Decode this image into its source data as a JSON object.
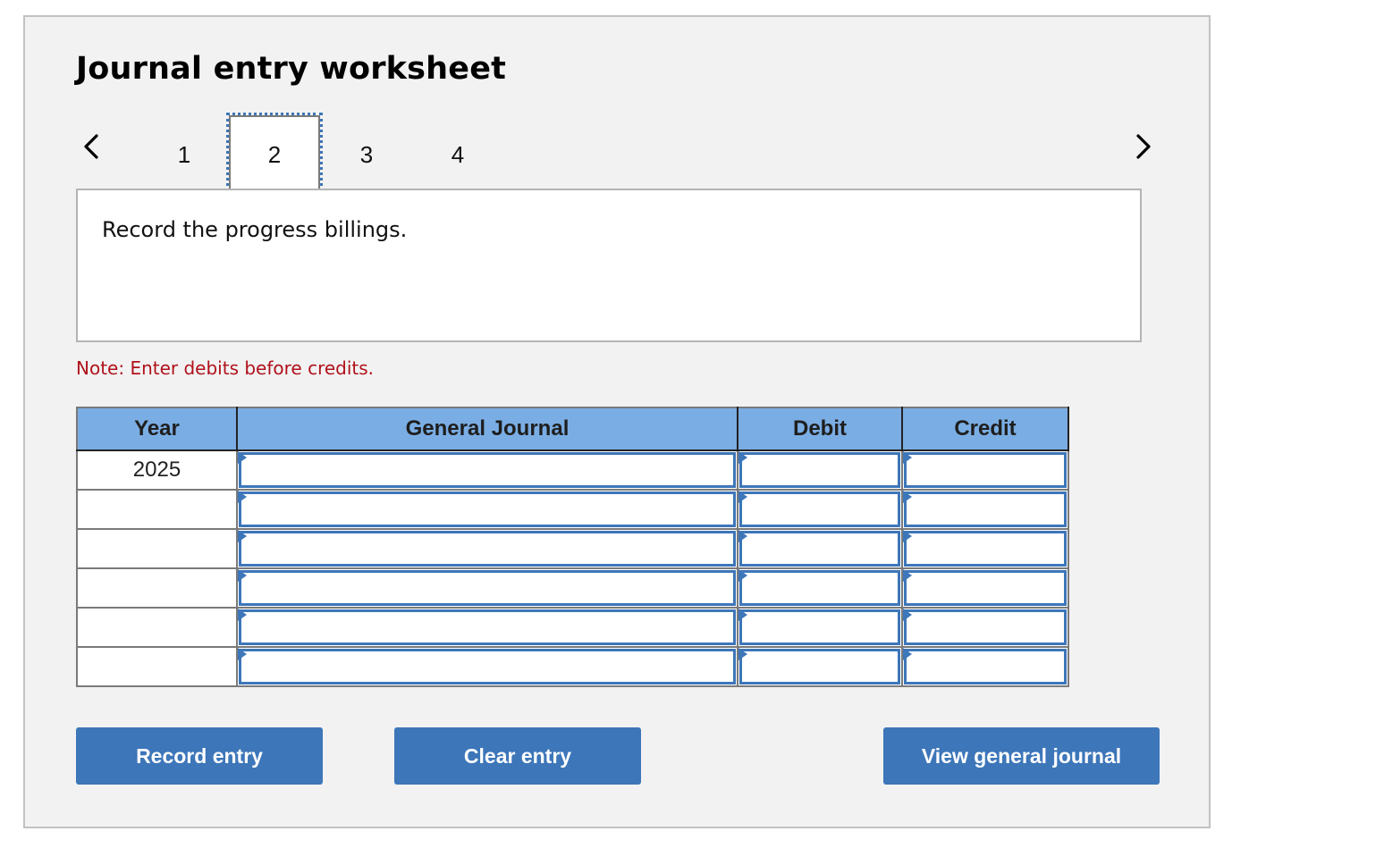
{
  "title": "Journal entry worksheet",
  "pager": {
    "prev_icon": "chevron-left-icon",
    "next_icon": "chevron-right-icon",
    "pages": [
      "1",
      "2",
      "3",
      "4"
    ],
    "selected_page": "2"
  },
  "prompt": "Record the progress billings.",
  "note": "Note: Enter debits before credits.",
  "table": {
    "headers": [
      "Year",
      "General Journal",
      "Debit",
      "Credit"
    ],
    "rows": [
      {
        "year": "2025",
        "account": "",
        "debit": "",
        "credit": ""
      },
      {
        "year": "",
        "account": "",
        "debit": "",
        "credit": ""
      },
      {
        "year": "",
        "account": "",
        "debit": "",
        "credit": ""
      },
      {
        "year": "",
        "account": "",
        "debit": "",
        "credit": ""
      },
      {
        "year": "",
        "account": "",
        "debit": "",
        "credit": ""
      },
      {
        "year": "",
        "account": "",
        "debit": "",
        "credit": ""
      }
    ]
  },
  "buttons": {
    "record": "Record entry",
    "clear": "Clear entry",
    "view": "View general journal"
  },
  "colors": {
    "header_bg": "#7aade3",
    "button_bg": "#3d76b9",
    "note_text": "#b0121b",
    "panel_bg": "#f2f2f2"
  }
}
